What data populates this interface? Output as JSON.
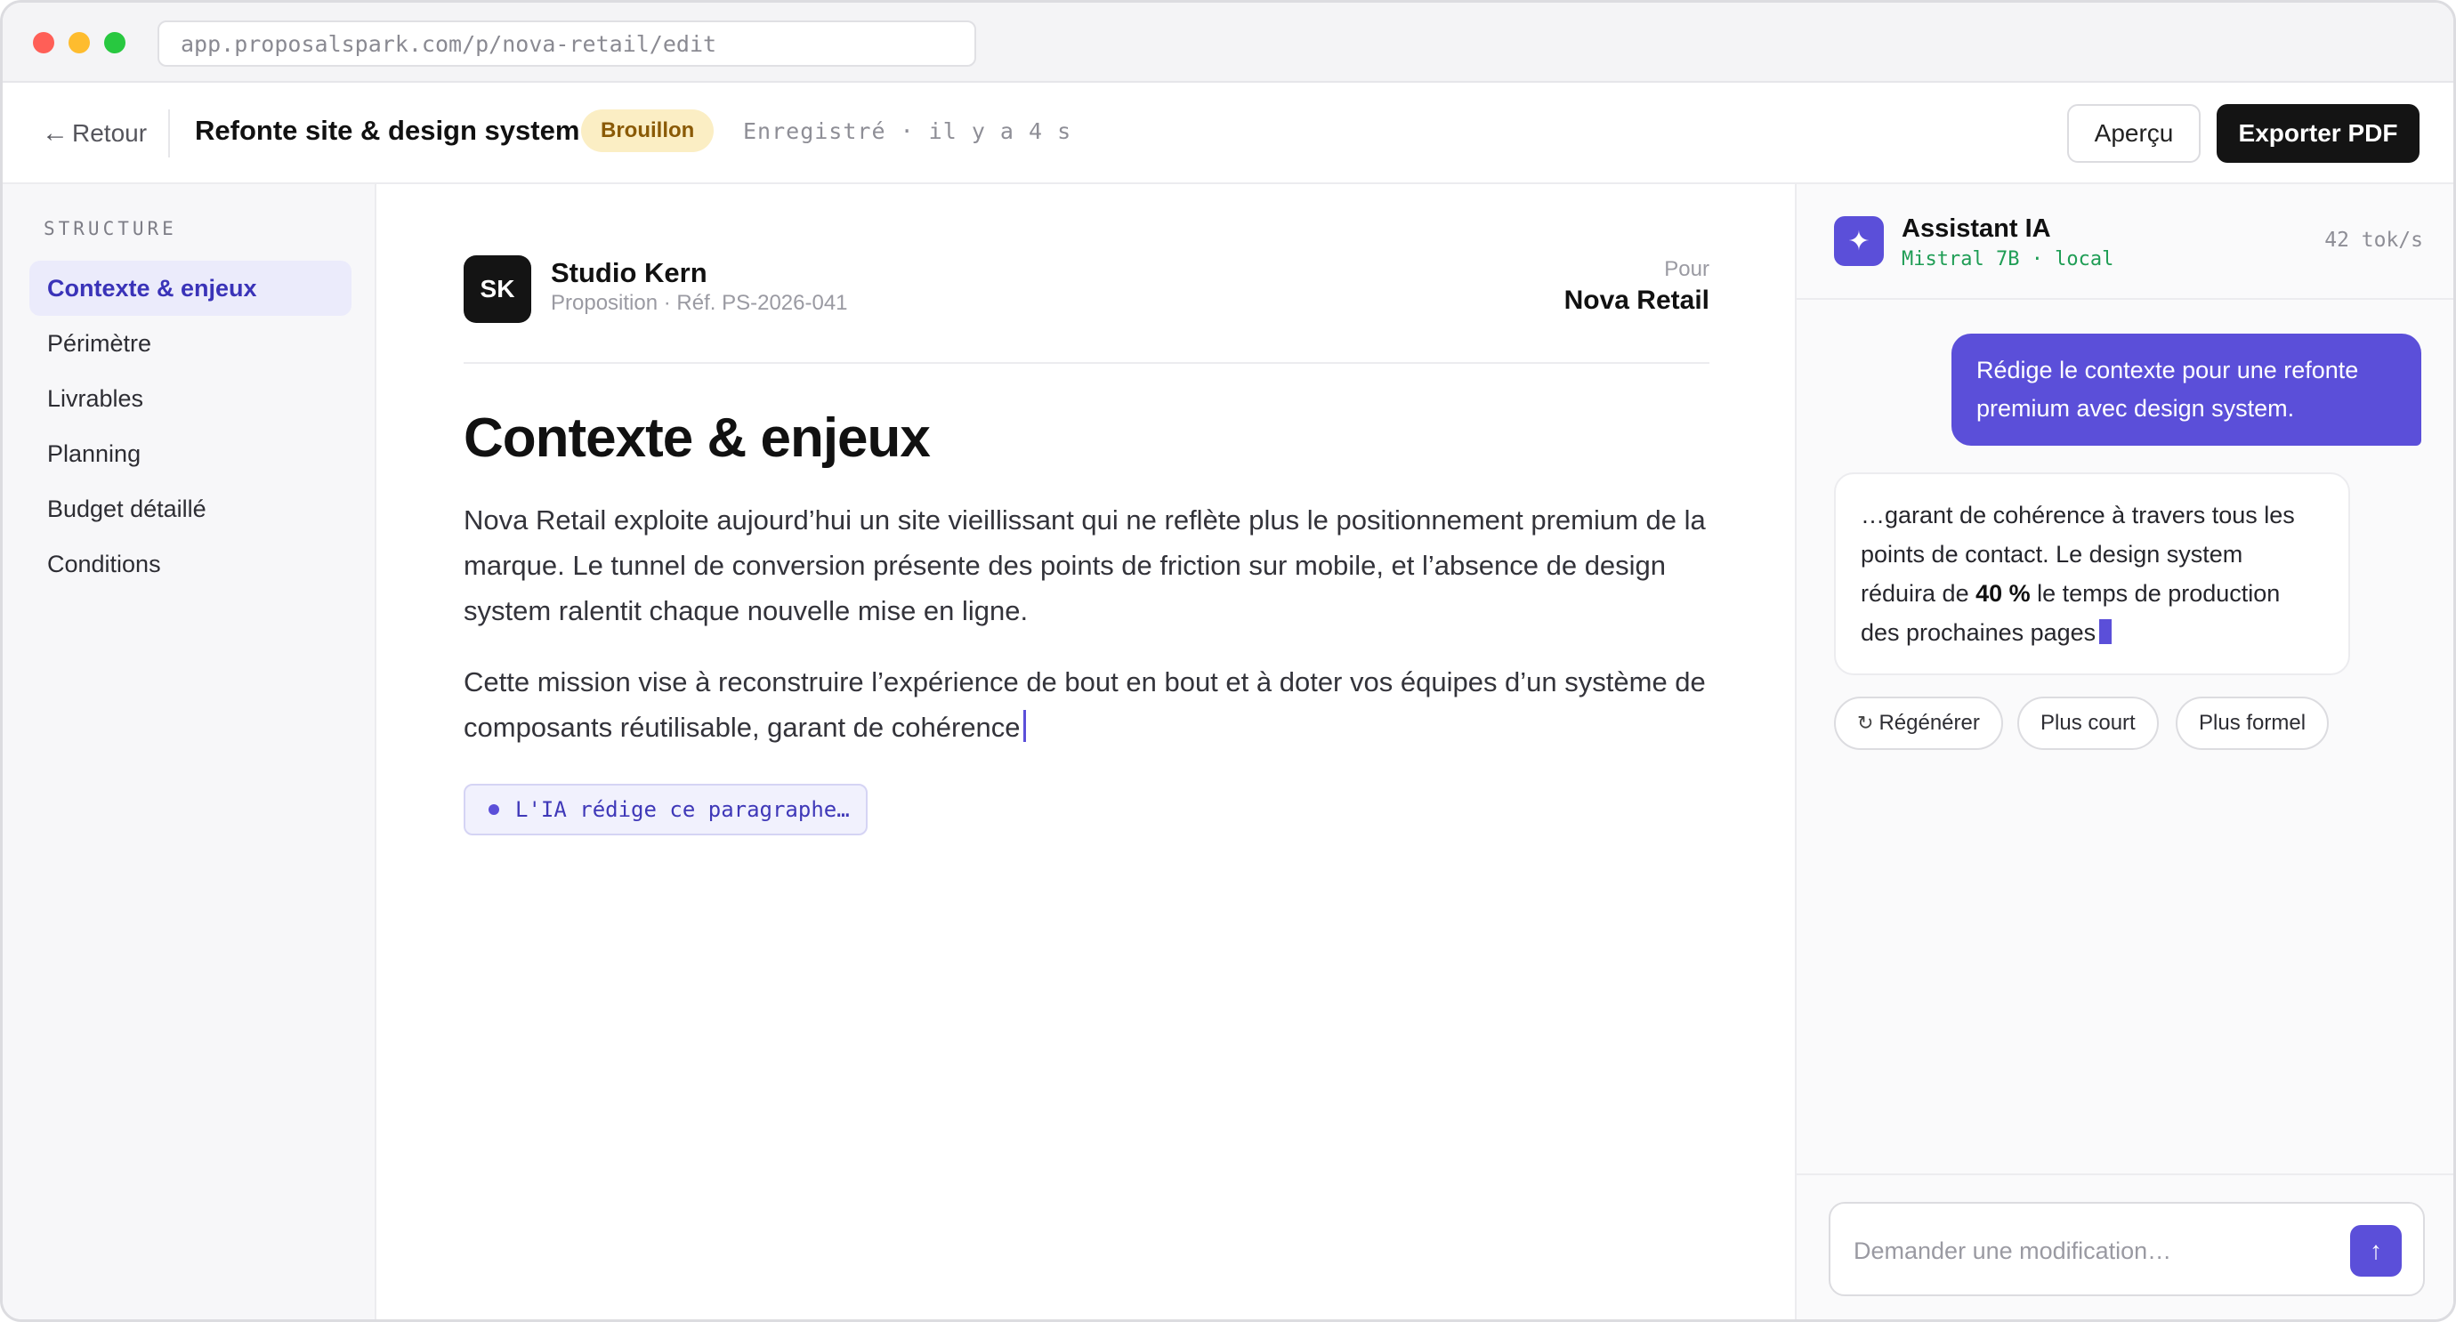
{
  "browser": {
    "url": "app.proposalspark.com/p/nova-retail/edit"
  },
  "header": {
    "back_label": "Retour",
    "doc_title": "Refonte site & design system",
    "status_badge": "Brouillon",
    "saved_status": "Enregistré · il y a 4 s",
    "preview_label": "Aperçu",
    "export_label": "Exporter PDF"
  },
  "sidebar": {
    "heading": "STRUCTURE",
    "items": [
      {
        "label": "Contexte & enjeux",
        "active": true
      },
      {
        "label": "Périmètre",
        "active": false
      },
      {
        "label": "Livrables",
        "active": false
      },
      {
        "label": "Planning",
        "active": false
      },
      {
        "label": "Budget détaillé",
        "active": false
      },
      {
        "label": "Conditions",
        "active": false
      }
    ]
  },
  "document": {
    "logo_initials": "SK",
    "company": "Studio Kern",
    "proposal_ref": "Proposition · Réf. PS-2026-041",
    "for_label": "Pour",
    "client": "Nova Retail",
    "section_title": "Contexte & enjeux",
    "paragraph_1": "Nova Retail exploite aujourd’hui un site vieillissant qui ne reflète plus le positionnement premium de la marque. Le tunnel de conversion présente des points de friction sur mobile, et l’absence de design system ralentit chaque nouvelle mise en ligne.",
    "paragraph_2": "Cette mission vise à reconstruire l’expérience de bout en bout et à doter vos équipes d’un système de composants réutilisable, garant de cohérence",
    "ai_status": "L'IA rédige ce paragraphe…"
  },
  "assistant": {
    "title": "Assistant IA",
    "model": "Mistral 7B · local",
    "rate": "42 tok/s",
    "user_message": "Rédige le contexte pour une refonte premium avec design system.",
    "ai_message_before": "…garant de cohérence à travers tous les points de contact. Le design system réduira de ",
    "ai_message_bold": "40 %",
    "ai_message_after": " le temps de production des prochaines pages",
    "chips": {
      "regenerate": "Régénérer",
      "shorter": "Plus court",
      "formal": "Plus formel"
    },
    "composer_placeholder": "Demander une modification…",
    "composer_value": ""
  },
  "colors": {
    "accent": "#5b4fd9",
    "draft_bg": "#fbeec4",
    "draft_text": "#8a5a06",
    "model_green": "#1f9d55",
    "export_bg": "#141414"
  },
  "icons": {
    "back": "arrow-left-icon",
    "assistant": "sparkle-icon",
    "regenerate": "refresh-icon",
    "send": "arrow-up-icon"
  }
}
